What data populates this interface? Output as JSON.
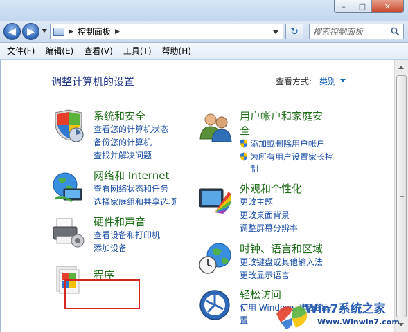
{
  "window": {
    "controls": {
      "minimize": "–",
      "maximize": "□",
      "close": "✕"
    }
  },
  "address": {
    "path_root_label": "控制面板",
    "separator": "▶"
  },
  "search": {
    "placeholder": "搜索控制面板"
  },
  "menu": {
    "items": [
      {
        "label": "文件(F)"
      },
      {
        "label": "编辑(E)"
      },
      {
        "label": "查看(V)"
      },
      {
        "label": "工具(T)"
      },
      {
        "label": "帮助(H)"
      }
    ]
  },
  "content": {
    "heading": "调整计算机的设置",
    "view_mode_label": "查看方式:",
    "view_mode_value": "类别"
  },
  "categories": {
    "system": {
      "title": "系统和安全",
      "links": [
        "查看您的计算机状态",
        "备份您的计算机",
        "查找并解决问题"
      ]
    },
    "network": {
      "title": "网络和 Internet",
      "links": [
        "查看网络状态和任务",
        "选择家庭组和共享选项"
      ]
    },
    "hardware": {
      "title": "硬件和声音",
      "links": [
        "查看设备和打印机",
        "添加设备"
      ]
    },
    "programs": {
      "title": "程序"
    },
    "users": {
      "title_line1": "用户帐户和家庭安",
      "title_line2": "全",
      "links": [
        "添加或删除用户帐户",
        "为所有用户设置家长控",
        "制"
      ]
    },
    "appearance": {
      "title": "外观和个性化",
      "links": [
        "更改主题",
        "更改桌面背景",
        "调整屏幕分辨率"
      ]
    },
    "clock": {
      "title": "时钟、语言和区域",
      "links": [
        "更改键盘或其他输入法",
        "更改显示语言"
      ]
    },
    "ease": {
      "title": "轻松访问",
      "links": [
        "使用 Windows 建议的设",
        "置"
      ]
    }
  },
  "watermark": {
    "title": "Win7系统之家",
    "url": "Www.Winwin7.com"
  },
  "colors": {
    "heading": "#1e3287",
    "category_title": "#1f6d18",
    "link": "#1a4da4",
    "highlight_box": "#d4281e"
  }
}
